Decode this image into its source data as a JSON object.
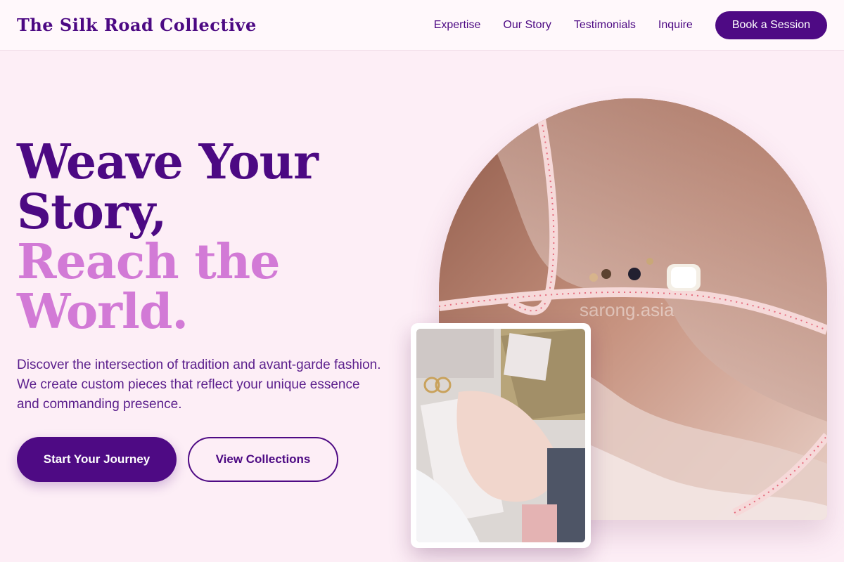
{
  "header": {
    "brand": "The Silk Road Collective",
    "nav": [
      "Expertise",
      "Our Story",
      "Testimonials",
      "Inquire"
    ],
    "cta": "Book a Session"
  },
  "hero": {
    "title_line1a": "Weave Your",
    "title_line1b": "Story,",
    "title_line2a": "Reach the",
    "title_line2b": "World.",
    "description": "Discover the intersection of tradition and avant-garde fashion. We create custom pieces that reflect your unique essence and commanding presence.",
    "primary_button": "Start Your Journey",
    "secondary_button": "View Collections"
  },
  "images": {
    "main_watermark": "sarong.asia",
    "main_image_icon": "silk-fabric-measuring-tape-image",
    "secondary_image_icon": "fabric-swatches-moodboard-image"
  },
  "colors": {
    "background": "#fdeef6",
    "brand_purple": "#4e0a84",
    "accent_pink": "#d27ad6"
  }
}
